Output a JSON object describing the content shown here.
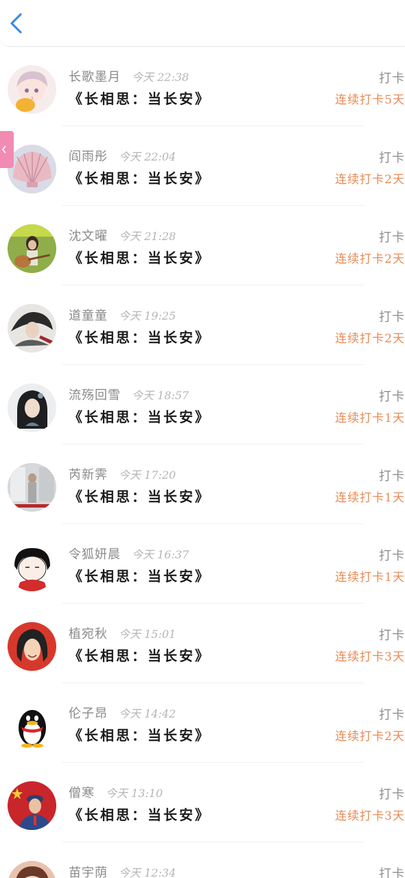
{
  "header": {
    "back_icon": "chevron-left-icon",
    "accent_color": "#3a8ee6"
  },
  "side_tab": {
    "color": "#f28bb3"
  },
  "entries": [
    {
      "name": "长歌墨月",
      "time": "今天 22:38",
      "book": "《长相思：当长安》",
      "action": "打卡",
      "streak": "连续打卡5天",
      "avatar": "anime-boy-avatar"
    },
    {
      "name": "阎雨彤",
      "time": "今天 22:04",
      "book": "《长相思：当长安》",
      "action": "打卡",
      "streak": "连续打卡2天",
      "avatar": "seashell-avatar"
    },
    {
      "name": "沈文曜",
      "time": "今天 21:28",
      "book": "《长相思：当长安》",
      "action": "打卡",
      "streak": "连续打卡2天",
      "avatar": "guitar-girl-avatar"
    },
    {
      "name": "道童童",
      "time": "今天 19:25",
      "book": "《长相思：当长安》",
      "action": "打卡",
      "streak": "连续打卡2天",
      "avatar": "ink-warrior-avatar"
    },
    {
      "name": "流殇回雪",
      "time": "今天 18:57",
      "book": "《长相思：当长安》",
      "action": "打卡",
      "streak": "连续打卡1天",
      "avatar": "ancient-lady-avatar"
    },
    {
      "name": "芮新霁",
      "time": "今天 17:20",
      "book": "《长相思：当长安》",
      "action": "打卡",
      "streak": "连续打卡1天",
      "avatar": "photo-avatar"
    },
    {
      "name": "令狐妍晨",
      "time": "今天 16:37",
      "book": "《长相思：当长安》",
      "action": "打卡",
      "streak": "连续打卡1天",
      "avatar": "cartoon-face-avatar"
    },
    {
      "name": "植宛秋",
      "time": "今天 15:01",
      "book": "《长相思：当长安》",
      "action": "打卡",
      "streak": "连续打卡3天",
      "avatar": "comic-woman-avatar"
    },
    {
      "name": "伦子昂",
      "time": "今天 14:42",
      "book": "《长相思：当长安》",
      "action": "打卡",
      "streak": "连续打卡2天",
      "avatar": "penguin-avatar"
    },
    {
      "name": "僧寒",
      "time": "今天 13:10",
      "book": "《长相思：当长安》",
      "action": "打卡",
      "streak": "连续打卡3天",
      "avatar": "soldier-avatar"
    },
    {
      "name": "苗宇荫",
      "time": "今天 12:34",
      "book": "",
      "action": "打卡",
      "streak": "",
      "avatar": "portrait-avatar"
    }
  ],
  "colors": {
    "streak": "#e98a54",
    "name": "#8a8a8a",
    "time": "#b5b5b5",
    "book": "#1c1c1c"
  }
}
